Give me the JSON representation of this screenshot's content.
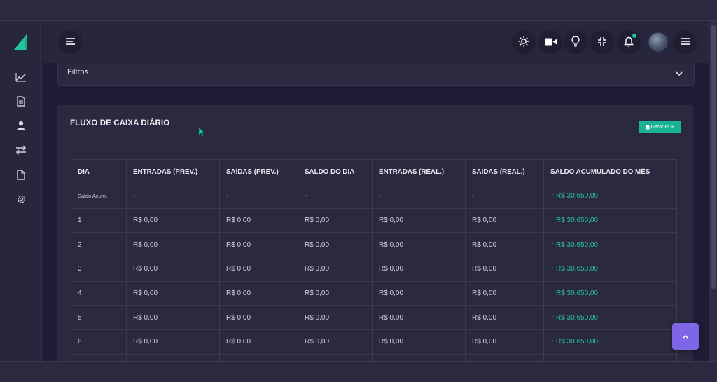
{
  "header": {
    "icons": [
      "menu-toggle-icon",
      "sun-icon",
      "video-camera-icon",
      "lightbulb-icon",
      "collapse-icon",
      "bell-icon",
      "avatar",
      "hamburger-icon"
    ]
  },
  "sidebar": {
    "items": [
      {
        "icon": "chart-line-icon"
      },
      {
        "icon": "document-icon"
      },
      {
        "icon": "user-icon"
      },
      {
        "icon": "transfer-icon"
      },
      {
        "icon": "file-icon"
      },
      {
        "icon": "gear-icon"
      }
    ]
  },
  "filters": {
    "label": "Filtros"
  },
  "cashflow": {
    "title": "FLUXO DE CAIXA DIÁRIO",
    "pdf_button": "Gerar PDF",
    "columns": [
      "DIA",
      "ENTRADAS (PREV.)",
      "SAÍDAS (PREV.)",
      "SALDO DO DIA",
      "ENTRADAS (REAL.)",
      "SAÍDAS (REAL.)",
      "SALDO ACUMULADO DO MÊS"
    ],
    "rows": [
      {
        "dia": "Saldo Acum.",
        "entradas_prev": "-",
        "saidas_prev": "-",
        "saldo_dia": "-",
        "entradas_real": "-",
        "saidas_real": "-",
        "saldo_acum": "R$ 30.650,00"
      },
      {
        "dia": "1",
        "entradas_prev": "R$ 0,00",
        "saidas_prev": "R$ 0,00",
        "saldo_dia": "R$ 0,00",
        "entradas_real": "R$ 0,00",
        "saidas_real": "R$ 0,00",
        "saldo_acum": "R$ 30.650,00"
      },
      {
        "dia": "2",
        "entradas_prev": "R$ 0,00",
        "saidas_prev": "R$ 0,00",
        "saldo_dia": "R$ 0,00",
        "entradas_real": "R$ 0,00",
        "saidas_real": "R$ 0,00",
        "saldo_acum": "R$ 30.650,00"
      },
      {
        "dia": "3",
        "entradas_prev": "R$ 0,00",
        "saidas_prev": "R$ 0,00",
        "saldo_dia": "R$ 0,00",
        "entradas_real": "R$ 0,00",
        "saidas_real": "R$ 0,00",
        "saldo_acum": "R$ 30.650,00"
      },
      {
        "dia": "4",
        "entradas_prev": "R$ 0,00",
        "saidas_prev": "R$ 0,00",
        "saldo_dia": "R$ 0,00",
        "entradas_real": "R$ 0,00",
        "saidas_real": "R$ 0,00",
        "saldo_acum": "R$ 30.650,00"
      },
      {
        "dia": "5",
        "entradas_prev": "R$ 0,00",
        "saidas_prev": "R$ 0,00",
        "saldo_dia": "R$ 0,00",
        "entradas_real": "R$ 0,00",
        "saidas_real": "R$ 0,00",
        "saldo_acum": "R$ 30.650,00"
      },
      {
        "dia": "6",
        "entradas_prev": "R$ 0,00",
        "saidas_prev": "R$ 0,00",
        "saldo_dia": "R$ 0,00",
        "entradas_real": "R$ 0,00",
        "saidas_real": "R$ 0,00",
        "saldo_acum": "R$ 30.650,00"
      }
    ]
  },
  "colors": {
    "accent": "#19b394",
    "positive": "#25c49c",
    "fab": "#7f66e6",
    "background": "#1d1c34",
    "card": "#2a293f"
  },
  "fab": {
    "icon": "chevron-up-icon"
  }
}
